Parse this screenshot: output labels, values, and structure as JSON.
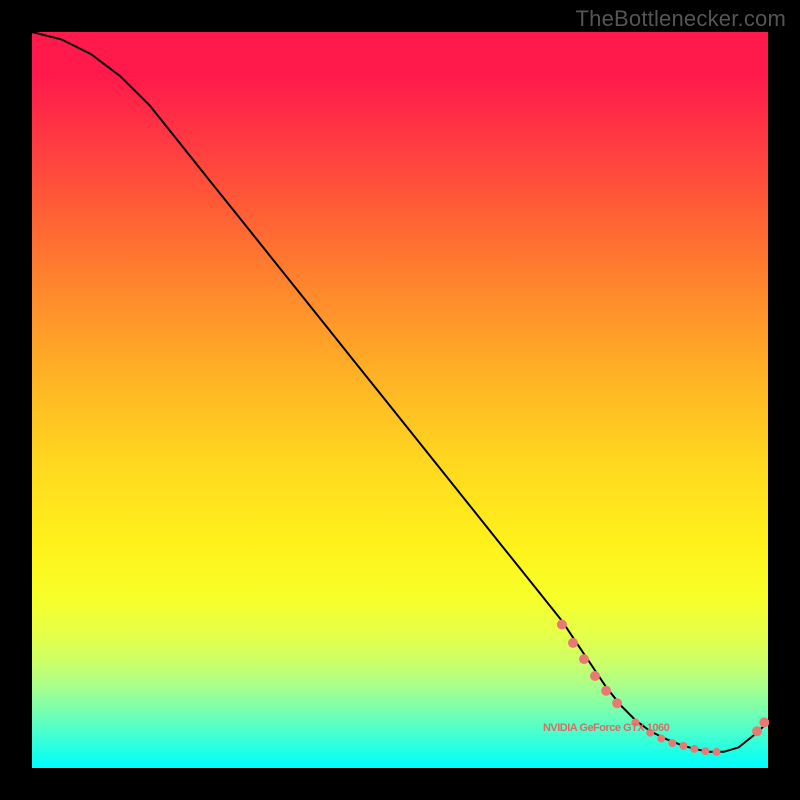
{
  "watermark": "TheBottlenecker.com",
  "colors": {
    "dot": "#e87a73",
    "curve": "#000000",
    "annot": "#d86e66"
  },
  "chart_data": {
    "type": "line",
    "title": "",
    "xlabel": "",
    "ylabel": "",
    "xlim": [
      0,
      100
    ],
    "ylim": [
      0,
      100
    ],
    "grid": false,
    "legend": false,
    "annotations": [
      {
        "text": "NVIDIA GeForce GTX 1060",
        "x": 78,
        "y": 5
      }
    ],
    "series": [
      {
        "name": "bottleneck-curve",
        "x": [
          0,
          4,
          8,
          12,
          16,
          20,
          24,
          28,
          32,
          36,
          40,
          44,
          48,
          52,
          56,
          60,
          64,
          68,
          72,
          74,
          76,
          78,
          80,
          82,
          84,
          86,
          88,
          90,
          92,
          94,
          96,
          98,
          100
        ],
        "y": [
          100,
          99,
          97,
          94,
          90,
          85,
          80,
          75,
          70,
          65,
          60,
          55,
          50,
          45,
          40,
          35,
          30,
          25,
          20,
          17,
          14,
          11,
          8.5,
          6.5,
          5.0,
          4.0,
          3.2,
          2.6,
          2.2,
          2.2,
          2.8,
          4.4,
          6.2
        ]
      }
    ],
    "marker_clusters": [
      {
        "cx": 72.0,
        "cy": 19.5,
        "r": 5
      },
      {
        "cx": 73.5,
        "cy": 17.0,
        "r": 5
      },
      {
        "cx": 75.0,
        "cy": 14.8,
        "r": 5
      },
      {
        "cx": 76.5,
        "cy": 12.5,
        "r": 5
      },
      {
        "cx": 78.0,
        "cy": 10.5,
        "r": 5
      },
      {
        "cx": 79.5,
        "cy": 8.8,
        "r": 5
      },
      {
        "cx": 82.0,
        "cy": 6.2,
        "r": 4
      },
      {
        "cx": 84.0,
        "cy": 4.8,
        "r": 4
      },
      {
        "cx": 85.5,
        "cy": 4.0,
        "r": 4
      },
      {
        "cx": 87.0,
        "cy": 3.4,
        "r": 4
      },
      {
        "cx": 88.5,
        "cy": 3.0,
        "r": 4
      },
      {
        "cx": 90.0,
        "cy": 2.6,
        "r": 4
      },
      {
        "cx": 91.5,
        "cy": 2.3,
        "r": 4
      },
      {
        "cx": 93.0,
        "cy": 2.2,
        "r": 4
      },
      {
        "cx": 98.5,
        "cy": 5.0,
        "r": 5
      },
      {
        "cx": 99.5,
        "cy": 6.2,
        "r": 5
      }
    ]
  }
}
